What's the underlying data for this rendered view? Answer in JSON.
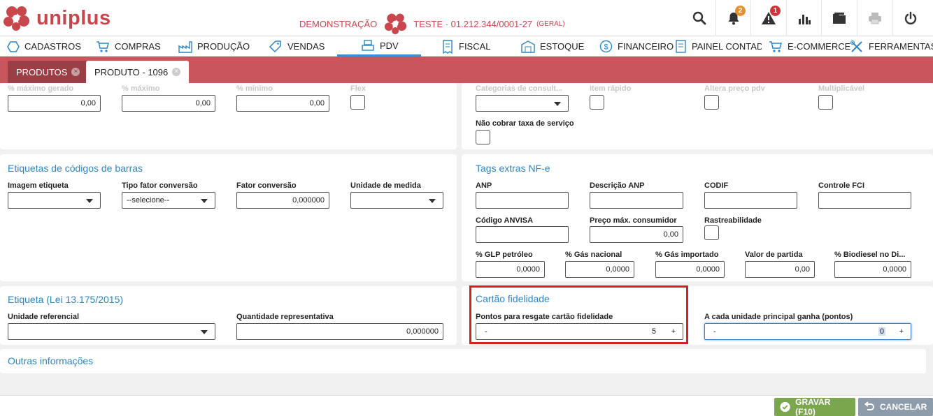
{
  "header": {
    "brand": "uniplus",
    "environment": "DEMONSTRAÇÃO",
    "company": "TESTE · 01.212.344/0001-27",
    "company_scope": "(GERAL)",
    "notifications_count": "2",
    "alerts_count": "1",
    "brand_color": "#c9464d"
  },
  "nav": {
    "items": [
      {
        "label": "CADASTROS",
        "icon": "hexagon-icon"
      },
      {
        "label": "COMPRAS",
        "icon": "cart-icon"
      },
      {
        "label": "PRODUÇÃO",
        "icon": "factory-icon"
      },
      {
        "label": "VENDAS",
        "icon": "tag-icon"
      },
      {
        "label": "PDV",
        "icon": "register-icon"
      },
      {
        "label": "FISCAL",
        "icon": "receipt-icon"
      },
      {
        "label": "ESTOQUE",
        "icon": "warehouse-icon"
      },
      {
        "label": "FINANCEIRO",
        "icon": "dollar-icon"
      },
      {
        "label": "PAINEL CONTADOR",
        "icon": "document-icon"
      },
      {
        "label": "E-COMMERCE",
        "icon": "cart-icon"
      },
      {
        "label": "FERRAMENTAS",
        "icon": "tools-icon"
      }
    ],
    "active": "PDV"
  },
  "tabs": [
    {
      "label": "PRODUTOS"
    },
    {
      "label": "PRODUTO - 1096"
    }
  ],
  "top_partial": {
    "left_labels": [
      "% máximo gerado",
      "% máximo",
      "% mínimo",
      "Flex"
    ],
    "left_values": [
      "0,00",
      "0,00",
      "0,00"
    ],
    "right_labels": [
      "Categorias de consult...",
      "Item rápido",
      "Altera preço pdv",
      "Multiplicável"
    ],
    "no_service_fee": "Não cobrar taxa de serviço"
  },
  "barcode_labels": {
    "title": "Etiquetas de códigos de barras",
    "image_label": "Imagem etiqueta",
    "factor_type_label": "Tipo fator conversão",
    "factor_type_value": "--selecione--",
    "factor_label": "Fator conversão",
    "factor_value": "0,000000",
    "unit_label": "Unidade de medida"
  },
  "nfe_tags": {
    "title": "Tags extras NF-e",
    "anp": "ANP",
    "anp_desc": "Descrição ANP",
    "codif": "CODIF",
    "fci": "Controle FCI",
    "anvisa": "Código ANVISA",
    "max_price": "Preço máx. consumidor",
    "max_price_value": "0,00",
    "traceability": "Rastreabilidade",
    "glp": "% GLP petróleo",
    "glp_value": "0,0000",
    "gas_nac": "% Gás nacional",
    "gas_nac_value": "0,0000",
    "gas_imp": "% Gás importado",
    "gas_imp_value": "0,0000",
    "start_value": "Valor de partida",
    "start_value_value": "0,00",
    "biodiesel": "% Biodiesel no Di...",
    "biodiesel_value": "0,0000"
  },
  "label_law": {
    "title": "Etiqueta (Lei 13.175/2015)",
    "ref_unit": "Unidade referencial",
    "rep_qty": "Quantidade representativa",
    "rep_qty_value": "0,000000"
  },
  "loyalty": {
    "title": "Cartão fidelidade",
    "redeem_label": "Pontos para resgate cartão fidelidade",
    "redeem_value": "5",
    "earn_label": "A cada unidade principal ganha (pontos)",
    "earn_value": "0",
    "minus": "-",
    "plus": "+"
  },
  "other": {
    "title": "Outras informações"
  },
  "footer": {
    "save": "GRAVAR (F10)",
    "cancel": "CANCELAR",
    "save_color": "#7aa64e",
    "cancel_color": "#8c9cab"
  }
}
